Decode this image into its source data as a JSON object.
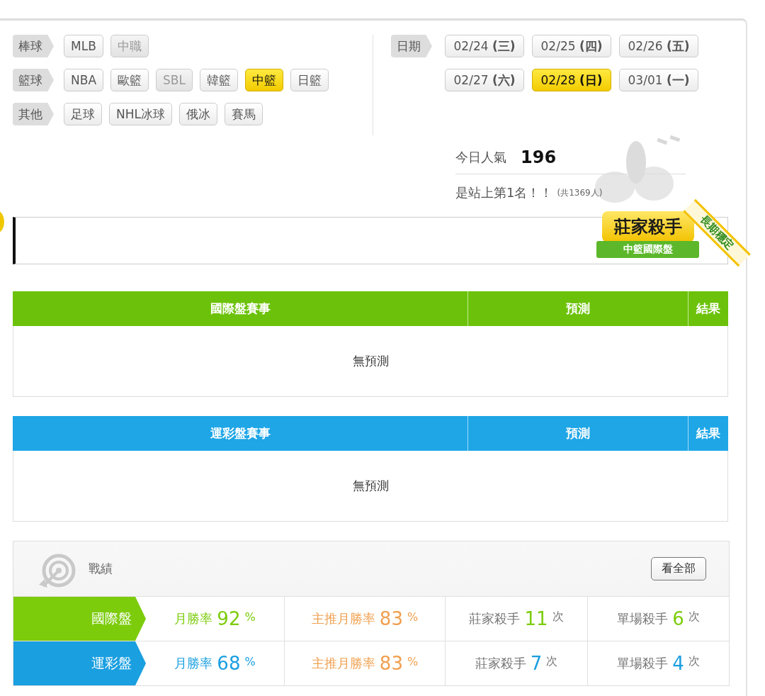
{
  "filters": [
    {
      "label": "棒球",
      "options": [
        {
          "text": "MLB",
          "selected": false,
          "disabled": false
        },
        {
          "text": "中職",
          "selected": false,
          "disabled": true
        }
      ]
    },
    {
      "label": "籃球",
      "options": [
        {
          "text": "NBA",
          "selected": false,
          "disabled": false
        },
        {
          "text": "歐籃",
          "selected": false,
          "disabled": false
        },
        {
          "text": "SBL",
          "selected": false,
          "disabled": true
        },
        {
          "text": "韓籃",
          "selected": false,
          "disabled": false
        },
        {
          "text": "中籃",
          "selected": true,
          "disabled": false
        },
        {
          "text": "日籃",
          "selected": false,
          "disabled": false
        }
      ]
    },
    {
      "label": "其他",
      "options": [
        {
          "text": "足球",
          "selected": false,
          "disabled": false
        },
        {
          "text": "NHL冰球",
          "selected": false,
          "disabled": false
        },
        {
          "text": "俄冰",
          "selected": false,
          "disabled": false
        },
        {
          "text": "賽馬",
          "selected": false,
          "disabled": false
        }
      ]
    }
  ],
  "dates": {
    "label": "日期",
    "options": [
      {
        "date": "02/24",
        "weekday": "(三)",
        "selected": false
      },
      {
        "date": "02/25",
        "weekday": "(四)",
        "selected": false
      },
      {
        "date": "02/26",
        "weekday": "(五)",
        "selected": false
      },
      {
        "date": "02/27",
        "weekday": "(六)",
        "selected": false
      },
      {
        "date": "02/28",
        "weekday": "(日)",
        "selected": true
      },
      {
        "date": "03/01",
        "weekday": "(一)",
        "selected": false
      }
    ]
  },
  "popularity": {
    "label": "今日人氣",
    "value": "196",
    "rank_text": "是站上第1名！！",
    "total": "(共1369人)"
  },
  "badge": {
    "title": "莊家殺手",
    "subtitle": "中籃國際盤",
    "ribbon": "長期穩定"
  },
  "tables": [
    {
      "color": "#6cc20a",
      "columns": [
        "國際盤賽事",
        "預測",
        "結果"
      ],
      "empty_message": "無預測"
    },
    {
      "color": "#1ea6e6",
      "columns": [
        "運彩盤賽事",
        "預測",
        "結果"
      ],
      "empty_message": "無預測"
    }
  ],
  "record": {
    "title": "戰績",
    "view_all": "看全部",
    "rows": [
      {
        "name": "國際盤",
        "color": "#7ccc0c",
        "monthly_label": "月勝率",
        "monthly": "92",
        "main_label": "主推月勝率",
        "main": "83",
        "banker_label": "莊家殺手",
        "banker": "11",
        "single_label": "單場殺手",
        "single": "6",
        "monthly_unit": "%",
        "main_unit": "%",
        "banker_unit": "次",
        "single_unit": "次"
      },
      {
        "name": "運彩盤",
        "color": "#1a9fe0",
        "monthly_label": "月勝率",
        "monthly": "68",
        "main_label": "主推月勝率",
        "main": "83",
        "banker_label": "莊家殺手",
        "banker": "7",
        "single_label": "單場殺手",
        "single": "4",
        "monthly_unit": "%",
        "main_unit": "%",
        "banker_unit": "次",
        "single_unit": "次"
      }
    ]
  }
}
